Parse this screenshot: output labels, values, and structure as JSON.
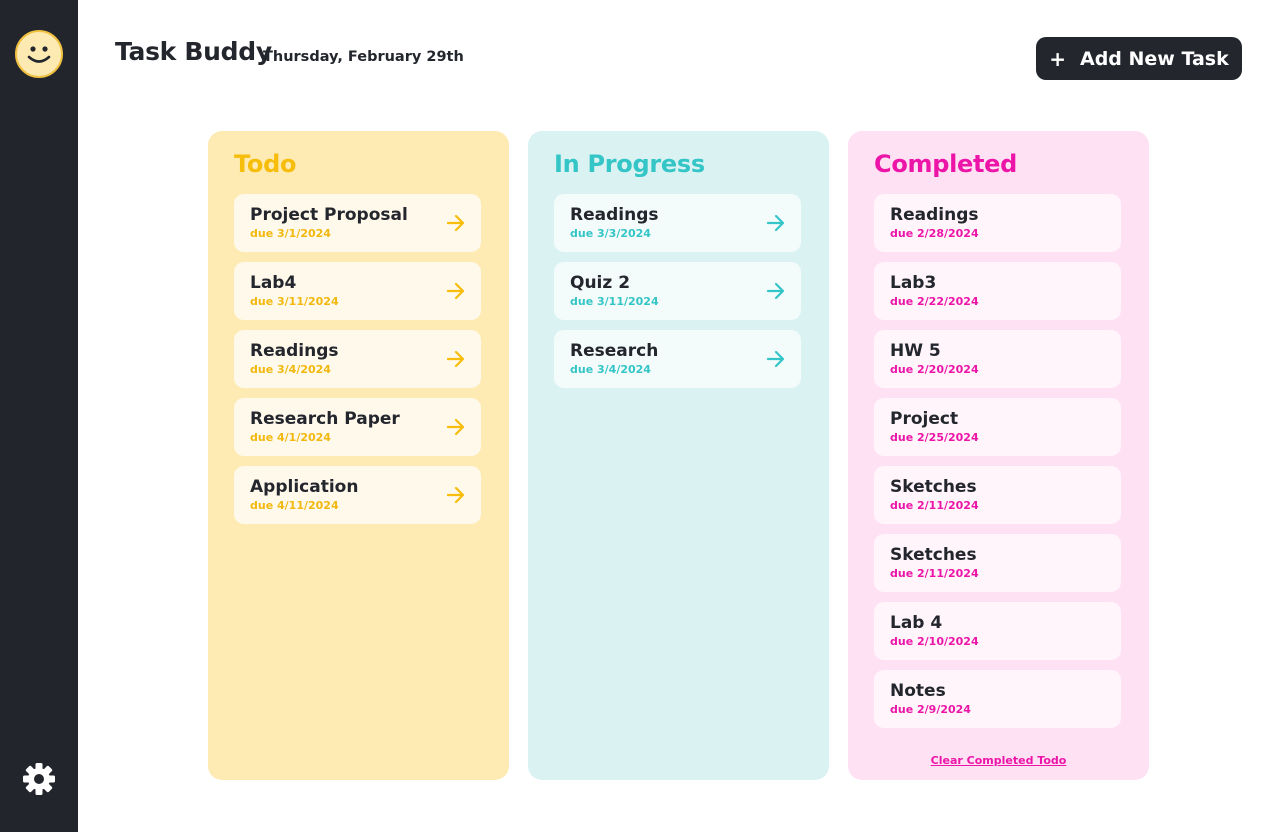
{
  "app": {
    "title": "Task Buddy",
    "date": "Thursday, February 29th"
  },
  "colors": {
    "todo": "#f7bd0b",
    "in_progress": "#34c5c7",
    "completed": "#ec15a8",
    "dark": "#23262d"
  },
  "sidebar": {
    "avatar_icon": "smiley-face-icon",
    "settings_icon": "gear-icon"
  },
  "header": {
    "add_button_icon": "plus-icon",
    "add_button_label": "Add New Task"
  },
  "columns": {
    "todo": {
      "title": "Todo",
      "tasks": [
        {
          "title": "Project Proposal",
          "due": "due 3/1/2024"
        },
        {
          "title": "Lab4",
          "due": "due 3/11/2024"
        },
        {
          "title": "Readings",
          "due": "due 3/4/2024"
        },
        {
          "title": "Research Paper",
          "due": "due 4/1/2024"
        },
        {
          "title": "Application",
          "due": "due 4/11/2024"
        }
      ]
    },
    "in_progress": {
      "title": "In Progress",
      "tasks": [
        {
          "title": "Readings",
          "due": "due 3/3/2024"
        },
        {
          "title": "Quiz 2",
          "due": "due 3/11/2024"
        },
        {
          "title": "Research",
          "due": "due 3/4/2024"
        }
      ]
    },
    "completed": {
      "title": "Completed",
      "tasks": [
        {
          "title": "Readings",
          "due": "due 2/28/2024"
        },
        {
          "title": "Lab3",
          "due": "due 2/22/2024"
        },
        {
          "title": "HW 5",
          "due": "due 2/20/2024"
        },
        {
          "title": "Project",
          "due": "due 2/25/2024"
        },
        {
          "title": "Sketches",
          "due": "due 2/11/2024"
        },
        {
          "title": "Sketches",
          "due": "due 2/11/2024"
        },
        {
          "title": "Lab 4",
          "due": "due 2/10/2024"
        },
        {
          "title": "Notes",
          "due": "due 2/9/2024"
        }
      ],
      "clear_label": "Clear Completed Todo"
    }
  }
}
